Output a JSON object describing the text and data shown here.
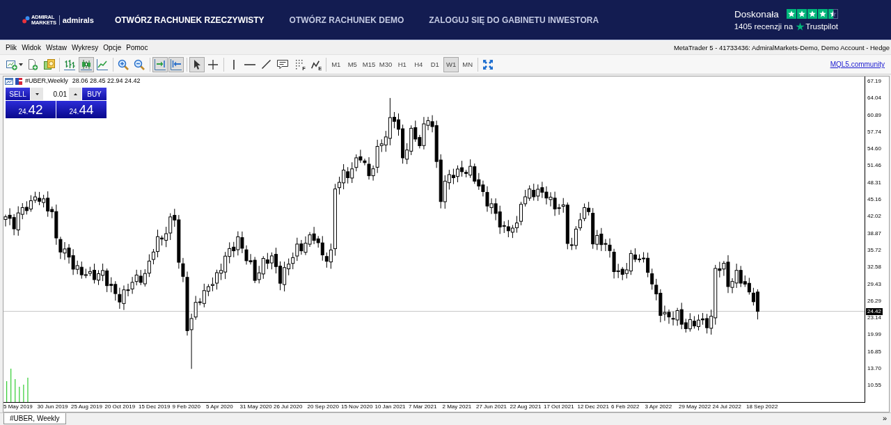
{
  "header": {
    "logo": {
      "wordmark": [
        "ADMIRAL",
        "MARKETS"
      ],
      "brand": "admirals"
    },
    "nav": [
      {
        "label": "OTWÓRZ RACHUNEK RZECZYWISTY",
        "highlighted": true
      },
      {
        "label": "OTWÓRZ RACHUNEK DEMO",
        "highlighted": false
      },
      {
        "label": "ZALOGUJ SIĘ DO GABINETU INWESTORA",
        "highlighted": false
      }
    ],
    "rating": {
      "label": "Doskonała",
      "stars": 4.5,
      "reviews": "1405 recenzji na",
      "site": "Trustpilot"
    }
  },
  "menu_bar": {
    "items": [
      "Plik",
      "Widok",
      "Wstaw",
      "Wykresy",
      "Opcje",
      "Pomoc"
    ],
    "account": "MetaTrader 5 - 41733436: AdmiralMarkets-Demo, Demo Account - Hedge"
  },
  "toolbar": {
    "tool_groups": [
      [
        {
          "selected": false
        },
        {
          "selected": false
        },
        {
          "selected": false
        }
      ],
      [
        {
          "selected": false
        },
        {
          "selected": true
        },
        {
          "selected": false
        }
      ],
      [
        {
          "selected": false
        },
        {
          "selected": false
        }
      ],
      [
        {
          "selected": true
        },
        {
          "selected": true
        }
      ],
      [
        {
          "selected": true
        },
        {
          "selected": false
        }
      ],
      [
        {
          "selected": false
        },
        {
          "selected": false
        },
        {
          "selected": false
        },
        {
          "selected": false
        },
        {
          "selected": false,
          "badge": "F"
        },
        {
          "selected": false,
          "badge": "E"
        }
      ]
    ],
    "timeframes": [
      {
        "label": "M1",
        "selected": false
      },
      {
        "label": "M5",
        "selected": false
      },
      {
        "label": "M15",
        "selected": false
      },
      {
        "label": "M30",
        "selected": false
      },
      {
        "label": "H1",
        "selected": false
      },
      {
        "label": "H4",
        "selected": false
      },
      {
        "label": "D1",
        "selected": false
      },
      {
        "label": "W1",
        "selected": true
      },
      {
        "label": "MN",
        "selected": false
      }
    ],
    "fullscreen": {
      "selected": false
    },
    "link": "MQL5.community"
  },
  "chart": {
    "symbol": "#UBER,Weekly",
    "ohlc": "28.06 28.45 22.94 24.42",
    "trade_panel": {
      "sell_label": "SELL",
      "buy_label": "BUY",
      "lot": "0.01",
      "sell_price": {
        "prefix": "24.",
        "main": "42"
      },
      "buy_price": {
        "prefix": "24.",
        "main": "44"
      }
    },
    "price_axis": [
      "67.19",
      "64.04",
      "60.89",
      "57.74",
      "54.60",
      "51.46",
      "48.31",
      "45.16",
      "42.02",
      "38.87",
      "35.72",
      "32.58",
      "29.43",
      "26.29",
      "23.14",
      "19.99",
      "16.85",
      "13.70",
      "10.55"
    ],
    "current_price": "24.42",
    "time_axis": [
      "5 May 2019",
      "30 Jun 2019",
      "25 Aug 2019",
      "20 Oct 2019",
      "15 Dec 2019",
      "9 Feb 2020",
      "5 Apr 2020",
      "31 May 2020",
      "26 Jul 2020",
      "20 Sep 2020",
      "15 Nov 2020",
      "10 Jan 2021",
      "7 Mar 2021",
      "2 May 2021",
      "27 Jun 2021",
      "22 Aug 2021",
      "17 Oct 2021",
      "12 Dec 2021",
      "6 Feb 2022",
      "3 Apr 2022",
      "29 May 2022",
      "24 Jul 2022",
      "18 Sep 2022"
    ]
  },
  "tabs": [
    {
      "label": "#UBER, Weekly",
      "selected": true
    }
  ],
  "tab_scroll": "»"
}
